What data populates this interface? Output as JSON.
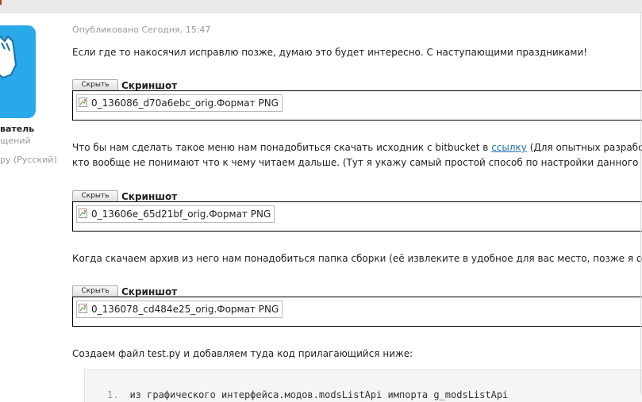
{
  "author": {
    "name": "ватель",
    "subtitle": "щений",
    "language": "ру (Русский)"
  },
  "post": {
    "published": "Опубликовано Сегодня, 15:47",
    "paragraph1": "Если где то накосячил исправлю позже, думаю это будет интересно. С наступающими праздниками!",
    "paragraph2_before_link": "Что бы нам сделать такое меню нам понадобиться скачать исходник с bitbucket в ",
    "paragraph2_link": "ссылку",
    "paragraph2_after_link": " (Для опытных разработчико",
    "paragraph2_line2": "кто вообще не понимают что к чему читаем дальше. (Тут я укажу самый простой способ по настройки данного меню)",
    "paragraph3": "Когда скачаем архив из него нам понадобиться папка сборки (её извлеките в удобное для вас место, позже я объясн",
    "paragraph4": "Создаем файл test.py и добавляем туда код прилагающийся ниже:",
    "spoilers": [
      {
        "button": "Скрыть",
        "title": "Скриншот",
        "image_alt": "0_136086_d70a6ebc_orig.Формат PNG"
      },
      {
        "button": "Скрыть",
        "title": "Скриншот",
        "image_alt": "0_13606e_65d21bf_orig.Формат PNG"
      },
      {
        "button": "Скрыть",
        "title": "Скриншот",
        "image_alt": "0_136078_cd484e25_orig.Формат PNG"
      }
    ],
    "code": {
      "line_number": "1.",
      "line": "из графического интерфейса.модов.modsListApi импорта g_modsListApi"
    }
  },
  "colors": {
    "accent_avatar": "#29a8ea",
    "link": "#1f6fb5",
    "meta_text": "#999999"
  }
}
